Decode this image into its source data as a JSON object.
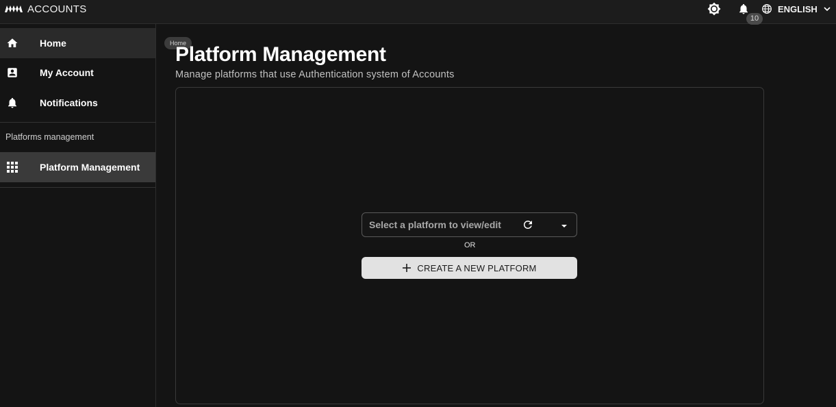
{
  "header": {
    "app_title": "ACCOUNTS",
    "theme_icon": "brightness-icon",
    "notifications": {
      "icon": "bell-icon",
      "badge_count": "10"
    },
    "language": {
      "icon": "globe-icon",
      "label": "ENGLISH",
      "chevron_icon": "chevron-down-icon"
    }
  },
  "sidebar": {
    "items": [
      {
        "label": "Home",
        "icon": "home-icon"
      },
      {
        "label": "My Account",
        "icon": "account-box-icon"
      },
      {
        "label": "Notifications",
        "icon": "bell-icon"
      }
    ],
    "section_label": "Platforms management",
    "section_items": [
      {
        "label": "Platform Management",
        "icon": "grid-icon",
        "selected": true
      }
    ]
  },
  "breadcrumb": {
    "home_label": "Home"
  },
  "main": {
    "title": "Platform Management",
    "subtitle": "Manage platforms that use Authentication system of Accounts",
    "select": {
      "placeholder": "Select a platform to view/edit",
      "refresh_icon": "refresh-icon",
      "caret_icon": "caret-down-icon"
    },
    "or_label": "OR",
    "create_button": {
      "label": "CREATE A NEW PLATFORM",
      "icon": "plus-icon"
    }
  }
}
